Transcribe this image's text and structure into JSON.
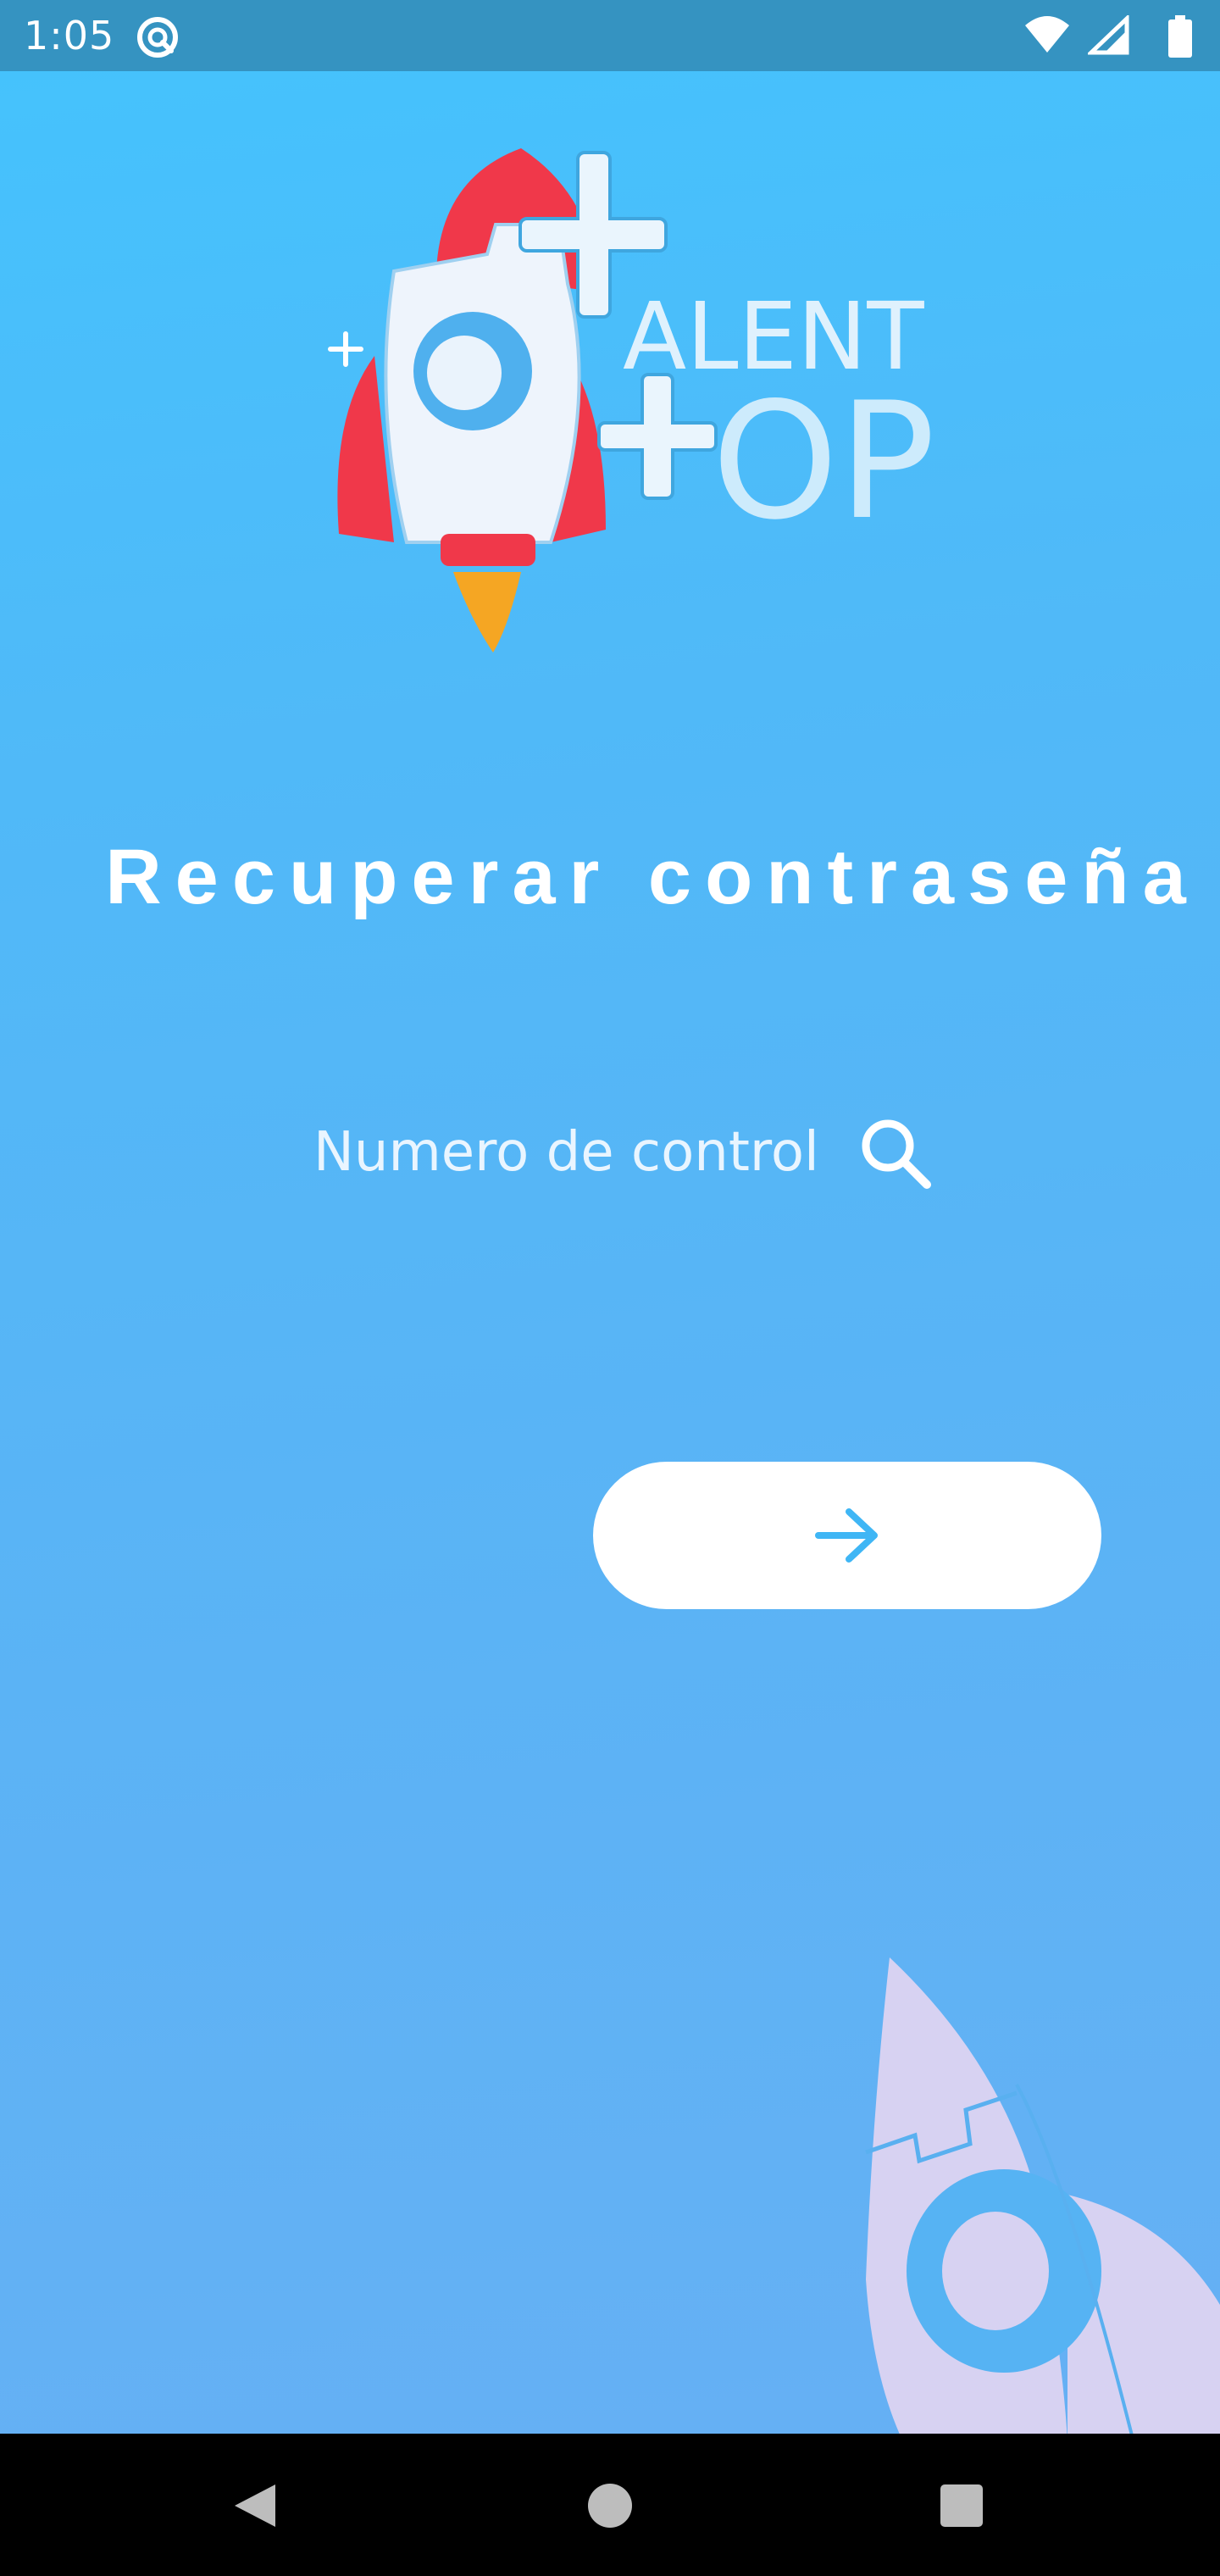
{
  "status_bar": {
    "time": "1:05",
    "icons": [
      "app-notification-icon",
      "wifi-icon",
      "cell-signal-icon",
      "battery-icon"
    ]
  },
  "logo": {
    "line1": "ALENT",
    "line2": "OP",
    "description": "rocket-logo"
  },
  "page": {
    "title": "Recuperar contraseña"
  },
  "form": {
    "control_number": {
      "value": "",
      "placeholder": "Numero de control"
    },
    "search_icon": "search-icon",
    "submit_icon": "arrow-right-icon"
  },
  "navigation": {
    "back": "back-icon",
    "home": "home-icon",
    "recents": "recents-icon"
  },
  "colors": {
    "background_top": "#44c3fd",
    "background_bottom": "#66b0f4",
    "status_bar": "#3593c1",
    "accent": "#3fb6f5",
    "rocket_red": "#f0384a",
    "flame": "#f5a623",
    "watermark_rocket": "#d7d2f2"
  }
}
